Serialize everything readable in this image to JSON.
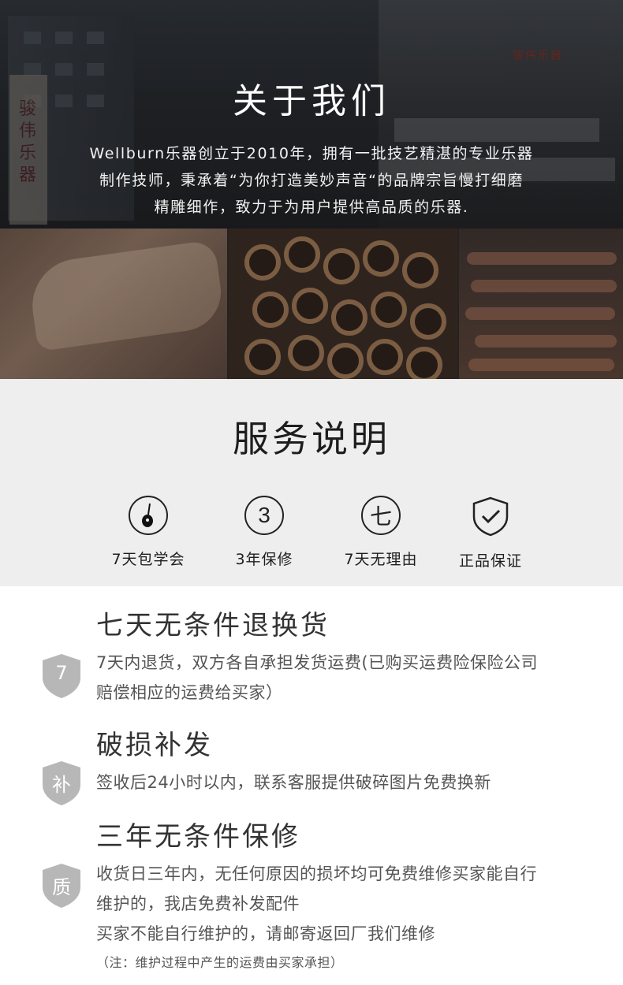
{
  "about": {
    "title": "关于我们",
    "lines": [
      "Wellburn乐器创立于2010年，拥有一批技艺精湛的专业乐器",
      "制作技师，秉承着“为你打造美妙声音“的品牌宗旨慢打细磨",
      "精雕细作，致力于为用户提供高品质的乐器."
    ],
    "background_pillar_text": "骏伟乐器",
    "background_sign_text": "骏伟乐器"
  },
  "service": {
    "title": "服务说明",
    "features": [
      {
        "icon": "guitar-icon",
        "glyph": "",
        "label": "7天包学会"
      },
      {
        "icon": "three-circle-icon",
        "glyph": "3",
        "label": "3年保修"
      },
      {
        "icon": "seven-circle-icon",
        "glyph": "七",
        "label": "7天无理由"
      },
      {
        "icon": "shield-check-icon",
        "glyph": "",
        "label": "正品保证"
      }
    ]
  },
  "policies": [
    {
      "badge": "7",
      "title": "七天无条件退换货",
      "lines": [
        "7天内退货，双方各自承担发货运费(已购买运费险保险公司",
        "赔偿相应的运费给买家）"
      ]
    },
    {
      "badge": "补",
      "title": "破损补发",
      "lines": [
        "签收后24小时以内，联系客服提供破碎图片免费换新"
      ]
    },
    {
      "badge": "质",
      "title": "三年无条件保修",
      "lines": [
        "收货日三年内，无任何原因的损坏均可免费维修买家能自行",
        "维护的，我店免费补发配件",
        "买家不能自行维护的，请邮寄返回厂我们维修"
      ]
    }
  ],
  "note": "（注：维护过程中产生的运费由买家承担）",
  "colors": {
    "badge_gray": "#b7b7b7",
    "service_bg": "#eeeeee",
    "title_dark": "#1e1e1e",
    "policy_text": "#555555"
  }
}
